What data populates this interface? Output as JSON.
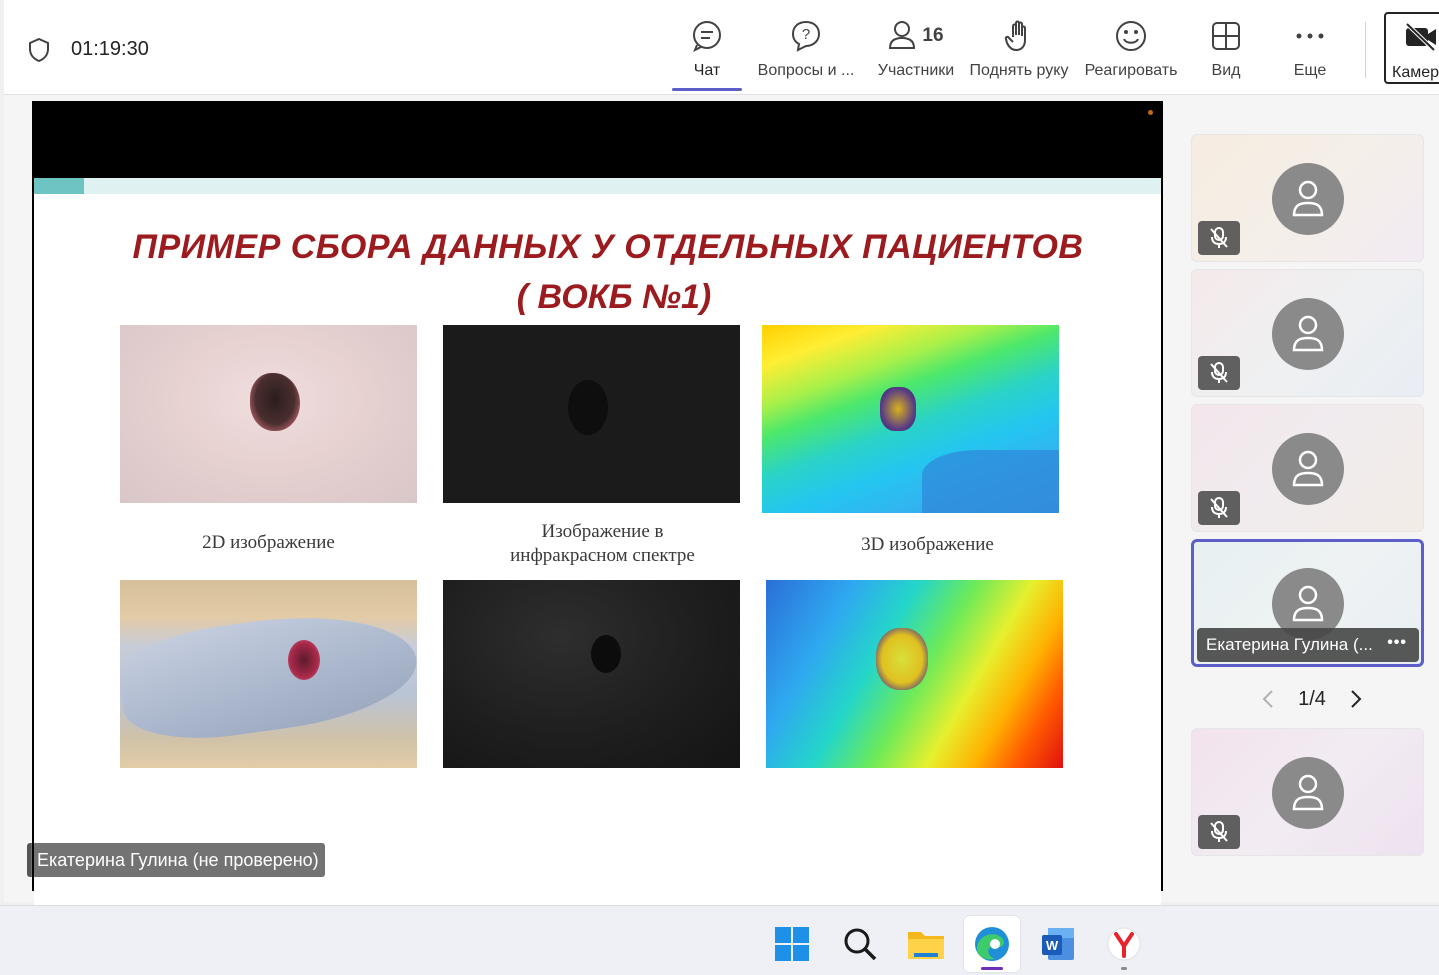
{
  "meeting": {
    "timer": "01:19:30"
  },
  "toolbar": {
    "chat_label": "Чат",
    "qa_label": "Вопросы и ...",
    "participants_label": "Участники",
    "participants_count": "16",
    "raise_hand_label": "Поднять руку",
    "react_label": "Реагировать",
    "view_label": "Вид",
    "more_label": "Еще",
    "camera_label": "Камера"
  },
  "slide": {
    "title": "ПРИМЕР СБОРА ДАННЫХ У ОТДЕЛЬНЫХ ПАЦИЕНТОВ",
    "subtitle": "( ВОКБ №1)",
    "captions": {
      "img2d": "2D изображение",
      "ir_line1": "Изображение в",
      "ir_line2": "инфракрасном спектре",
      "img3d": "3D изображение"
    }
  },
  "presenter": {
    "name_tag": "Екатерина Гулина (не проверено)"
  },
  "gallery": {
    "selected_name": "Екатерина Гулина (...",
    "more": "•••",
    "page": "1/4"
  },
  "colors": {
    "accent": "#5b5fc7",
    "title_red": "#9b1b1f"
  }
}
